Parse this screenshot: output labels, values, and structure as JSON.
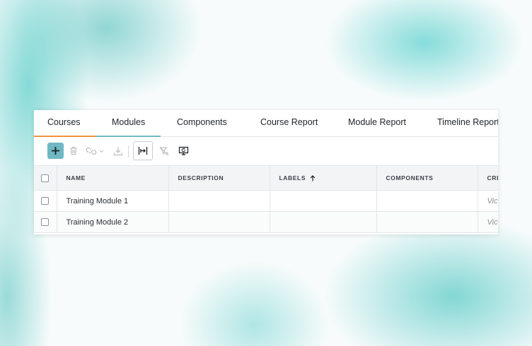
{
  "colors": {
    "accent": "#6fb8c4",
    "tab_active": "#f0913a",
    "tab_secondary": "#6fb8c4"
  },
  "tabs": [
    {
      "label": "Courses",
      "active": true
    },
    {
      "label": "Modules"
    },
    {
      "label": "Components"
    },
    {
      "label": "Course Report"
    },
    {
      "label": "Module Report"
    },
    {
      "label": "Timeline Report"
    }
  ],
  "toolbar": {
    "add": "plus-icon",
    "delete": "trash-icon",
    "link": "link-icon",
    "download": "download-icon",
    "fit_columns": "fit-columns-icon",
    "clear_filter": "filter-clear-icon",
    "refresh": "refresh-screen-icon"
  },
  "table": {
    "columns": [
      "NAME",
      "DESCRIPTION",
      "LABELS",
      "COMPONENTS",
      "CRE"
    ],
    "sorted_column": "LABELS",
    "rows": [
      {
        "name": "Training Module 1",
        "description": "",
        "labels": "",
        "components": "",
        "created": "Vict"
      },
      {
        "name": "Training Module 2",
        "description": "",
        "labels": "",
        "components": "",
        "created": "Vict"
      }
    ]
  }
}
